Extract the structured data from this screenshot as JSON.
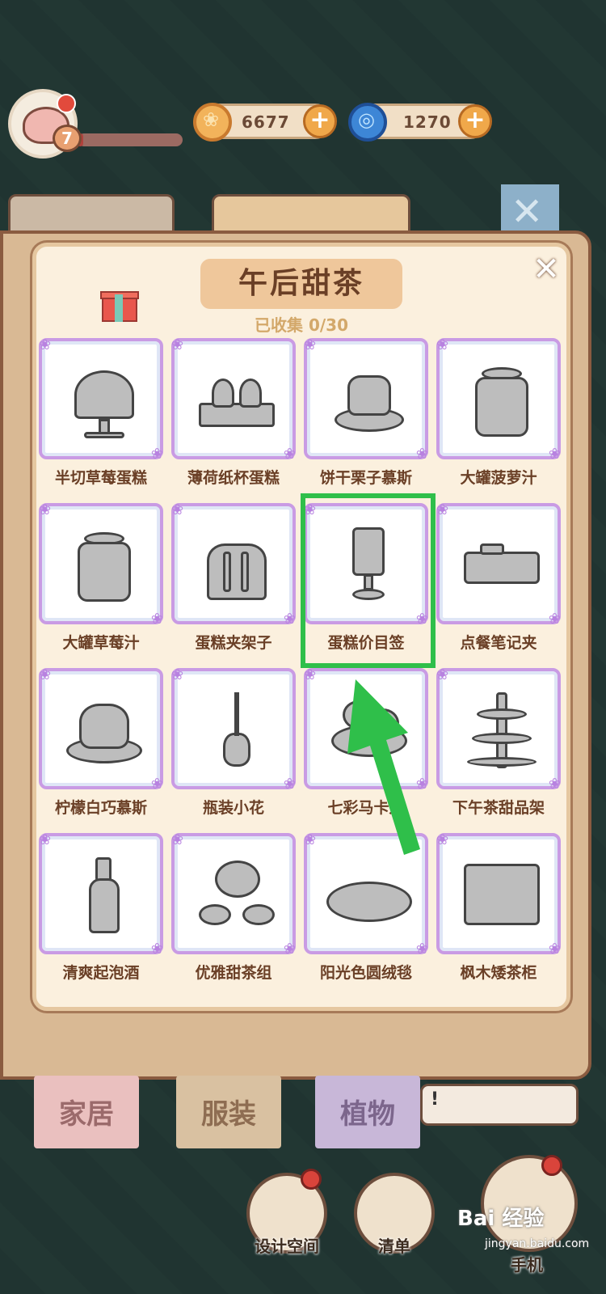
{
  "hud": {
    "level": "7",
    "xp_fraction": 0.05,
    "coins": "6677",
    "gems": "1270"
  },
  "panel": {
    "title": "午后甜茶",
    "subtitle": "已收集 0/30",
    "items": [
      {
        "name": "半切草莓蛋糕"
      },
      {
        "name": "薄荷纸杯蛋糕"
      },
      {
        "name": "饼干栗子慕斯"
      },
      {
        "name": "大罐菠萝汁"
      },
      {
        "name": "大罐草莓汁"
      },
      {
        "name": "蛋糕夹架子"
      },
      {
        "name": "蛋糕价目签"
      },
      {
        "name": "点餐笔记夹"
      },
      {
        "name": "柠檬白巧慕斯"
      },
      {
        "name": "瓶装小花"
      },
      {
        "name": "七彩马卡龙"
      },
      {
        "name": "下午茶甜品架"
      },
      {
        "name": "清爽起泡酒"
      },
      {
        "name": "优雅甜茶组"
      },
      {
        "name": "阳光色圆绒毯"
      },
      {
        "name": "枫木矮茶柜"
      }
    ]
  },
  "tabs": {
    "home": "家居",
    "clothing": "服装",
    "plants": "植物",
    "bubble": "!"
  },
  "bottom": {
    "design": "设计空间",
    "list": "清单",
    "phone": "手机"
  },
  "watermark": {
    "brand": "Bai 经验",
    "url": "jingyan.baidu.com"
  },
  "colors": {
    "highlight": "#2fbf4a",
    "title_bg": "#efc79b",
    "frame": "#c99be4"
  }
}
